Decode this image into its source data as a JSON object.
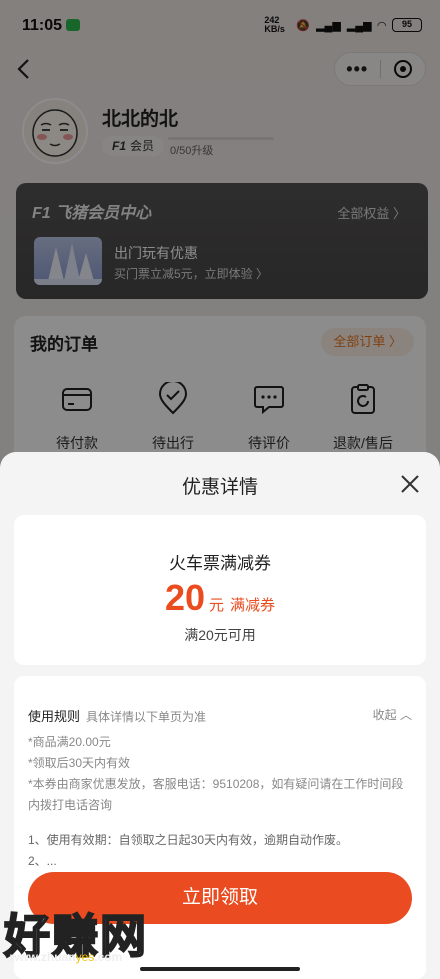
{
  "status_bar": {
    "time": "11:05",
    "net_speed": "242 KB/s",
    "battery": "95"
  },
  "profile": {
    "name": "北北的北",
    "member_level": "F1",
    "member_label": "会员",
    "upgrade_progress": "0/50升级"
  },
  "vip_card": {
    "title": "F1 飞猪会员中心",
    "all_benefits": "全部权益 〉",
    "promo_title": "出门玩有优惠",
    "promo_sub": "买门票立减5元，立即体验 〉"
  },
  "orders": {
    "title": "我的订单",
    "all_orders": "全部订单 〉",
    "items": [
      {
        "label": "待付款",
        "icon": "wallet-icon"
      },
      {
        "label": "待出行",
        "icon": "location-check-icon"
      },
      {
        "label": "待评价",
        "icon": "chat-bubble-icon"
      },
      {
        "label": "退款/售后",
        "icon": "refund-icon"
      }
    ]
  },
  "sheet": {
    "title": "优惠详情",
    "coupon": {
      "name": "火车票满减券",
      "amount": "20",
      "unit": "元",
      "type": "满减券",
      "condition": "满20元可用"
    },
    "rules": {
      "heading": "使用规则",
      "subheading": "具体详情以下单页为准",
      "collapse": "收起 ︿",
      "lines": [
        "*商品满20.00元",
        "*领取后30天内有效",
        "*本券由商家优惠发放，客服电话：9510208，如有疑问请在工作时间段内拨打电话咨询"
      ],
      "numbered": [
        "1、使用有效期：自领取之日起30天内有效，逾期自动作废。",
        "2、..."
      ]
    },
    "cta": "立即领取"
  },
  "watermark": {
    "brand": "好赚网",
    "url_prefix": "www.zhuan",
    "url_accent": "yes",
    "url_suffix": ".com"
  },
  "colors": {
    "accent": "#ea4b20",
    "orders_accent": "#e8761f",
    "vip_bg": "#4e4d4d"
  }
}
